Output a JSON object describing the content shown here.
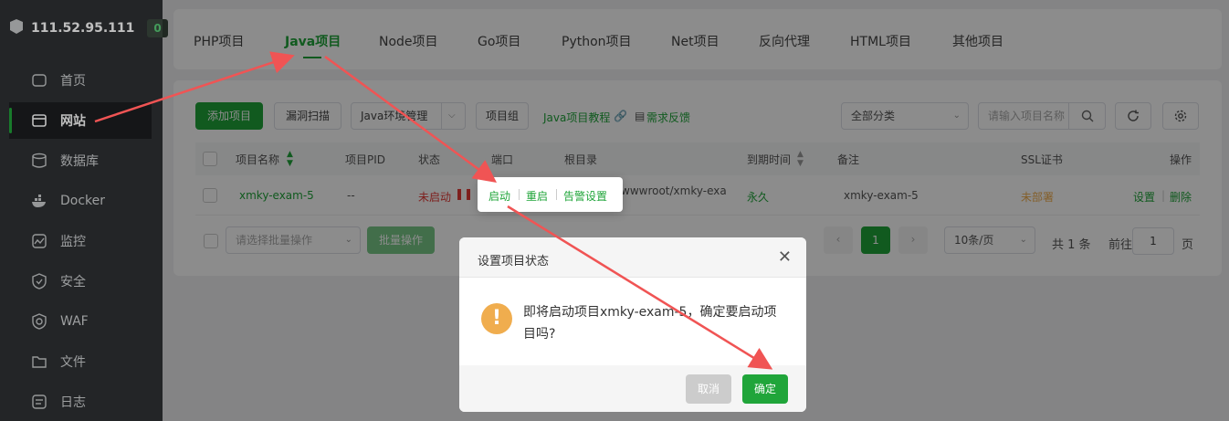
{
  "sidebar": {
    "ip": "111.52.95.111",
    "badge": "0",
    "items": [
      {
        "label": "首页",
        "icon": "home-icon"
      },
      {
        "label": "网站",
        "icon": "globe-icon"
      },
      {
        "label": "数据库",
        "icon": "database-icon"
      },
      {
        "label": "Docker",
        "icon": "docker-icon"
      },
      {
        "label": "监控",
        "icon": "monitor-icon"
      },
      {
        "label": "安全",
        "icon": "shield-icon"
      },
      {
        "label": "WAF",
        "icon": "waf-icon"
      },
      {
        "label": "文件",
        "icon": "folder-icon"
      },
      {
        "label": "日志",
        "icon": "log-icon"
      }
    ]
  },
  "tabs": [
    "PHP项目",
    "Java项目",
    "Node项目",
    "Go项目",
    "Python项目",
    "Net项目",
    "反向代理",
    "HTML项目",
    "其他项目"
  ],
  "toolbar": {
    "add": "添加项目",
    "scan": "漏洞扫描",
    "env": "Java环境管理",
    "group": "项目组",
    "tutorial": "Java项目教程",
    "feedback": "需求反馈",
    "category": "全部分类",
    "search_placeholder": "请输入项目名称"
  },
  "table": {
    "headers": [
      "项目名称",
      "项目PID",
      "状态",
      "端口",
      "根目录",
      "到期时间",
      "备注",
      "SSL证书",
      "操作"
    ],
    "row": {
      "name": "xmky-exam-5",
      "pid": "--",
      "status": "未启动",
      "root": "wwwroot/xmky-exa",
      "expire": "永久",
      "note": "xmky-exam-5",
      "ssl": "未部署",
      "op_settings": "设置",
      "op_delete": "删除"
    }
  },
  "batch": {
    "placeholder": "请选择批量操作",
    "button": "批量操作"
  },
  "pager": {
    "current": "1",
    "page_size": "10条/页",
    "total": "共 1 条",
    "goto": "前往",
    "goto_value": "1",
    "page_unit": "页"
  },
  "popover": {
    "start": "启动",
    "restart": "重启",
    "alert": "告警设置"
  },
  "modal": {
    "title": "设置项目状态",
    "message": "即将启动项目xmky-exam-5，确定要启动项目吗?",
    "cancel": "取消",
    "ok": "确定"
  },
  "colors": {
    "accent": "#20a53a",
    "danger": "#e53935",
    "warning": "#f0ad4e",
    "sidebar": "#2f3234",
    "arrow": "#f05454"
  }
}
